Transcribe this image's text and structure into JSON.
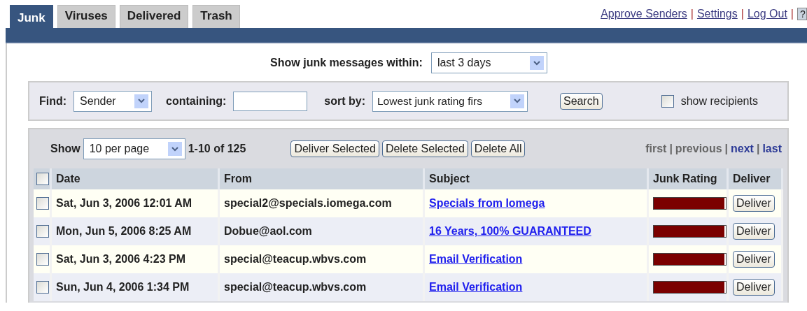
{
  "tabs": [
    {
      "label": "Junk",
      "selected": true
    },
    {
      "label": "Viruses",
      "selected": false
    },
    {
      "label": "Delivered",
      "selected": false
    },
    {
      "label": "Trash",
      "selected": false
    }
  ],
  "top_links": [
    "Approve Senders",
    "Settings",
    "Log Out"
  ],
  "top_separators": [
    "|",
    "|",
    "|"
  ],
  "help_button": "?",
  "period": {
    "label": "Show junk messages within:",
    "value": "last 3 days"
  },
  "find": {
    "label": "Find:",
    "field": "Sender",
    "containing_label": "containing:",
    "sort_label": "sort by:",
    "sort_value": "Lowest junk rating firs",
    "search_button": "Search",
    "show_recipients": {
      "label": "show recipients",
      "checked": false
    }
  },
  "toolbar": {
    "show_label": "Show",
    "per_page": "10 per page",
    "range": "1-10 of 125",
    "buttons": [
      "Deliver Selected",
      "Delete Selected",
      "Delete All"
    ],
    "pager": [
      {
        "label": "first",
        "disabled": true,
        "separator": "|"
      },
      {
        "label": "previous",
        "disabled": true,
        "separator": "|"
      },
      {
        "label": "next",
        "disabled": false,
        "separator": "|"
      },
      {
        "label": "last",
        "disabled": false
      }
    ]
  },
  "table": {
    "select_all": {
      "checked": false
    },
    "columns": [
      "Date",
      "From",
      "Subject",
      "Junk Rating",
      "Deliver"
    ],
    "rows": [
      {
        "checked": false,
        "date": "Sat, Jun 3, 2006 12:01 AM",
        "from": "special2@specials.iomega.com",
        "subject": "Specials from Iomega",
        "level": 0.98,
        "button": "Deliver"
      },
      {
        "checked": false,
        "date": "Mon, Jun 5, 2006 8:25 AM",
        "from": "Dobue@aol.com",
        "subject": "16 Years, 100% GUARANTEED",
        "level": 0.98,
        "button": "Deliver"
      },
      {
        "checked": false,
        "date": "Sat, Jun 3, 2006 4:23 PM",
        "from": "special@teacup.wbvs.com",
        "subject": "Email Verification",
        "level": 0.98,
        "button": "Deliver"
      },
      {
        "checked": false,
        "date": "Sun, Jun 4, 2006 1:34 PM",
        "from": "special@teacup.wbvs.com",
        "subject": "Email Verification",
        "level": 0.98,
        "button": "Deliver"
      }
    ]
  }
}
